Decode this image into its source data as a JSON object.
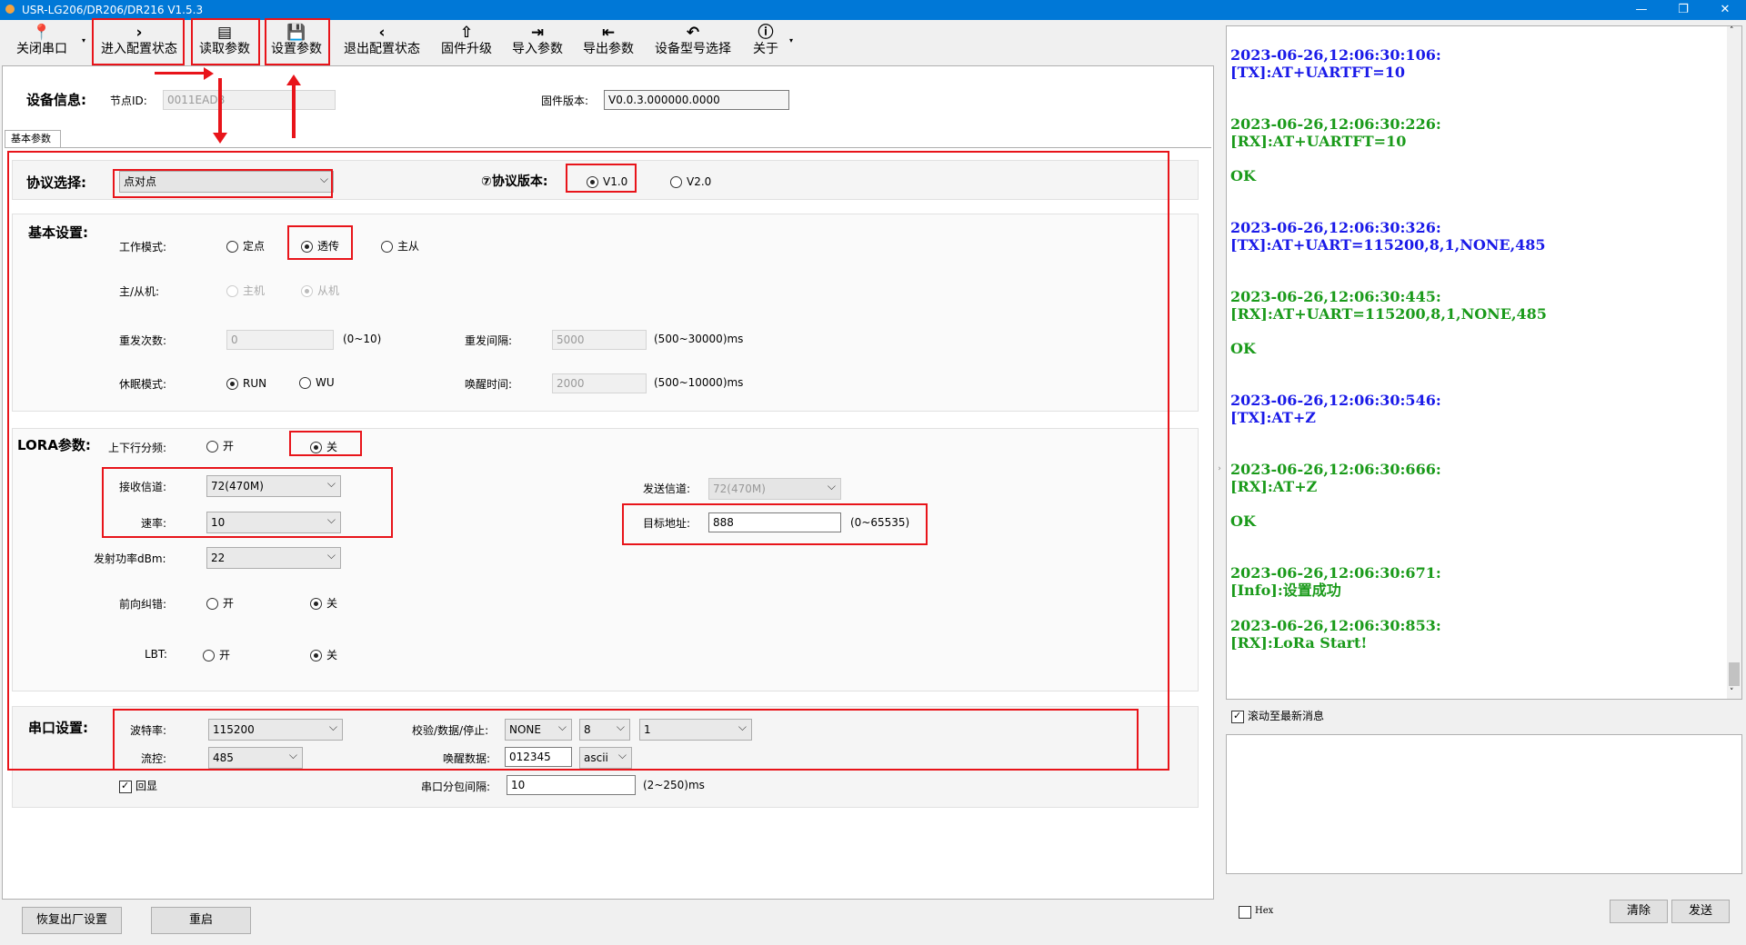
{
  "window": {
    "title": "USR-LG206/DR206/DR216 V1.5.3",
    "minimize": "—",
    "restore": "❐",
    "close": "✕"
  },
  "toolbar": {
    "items": [
      {
        "icon": "📍",
        "label": "关闭串口"
      },
      {
        "icon": "›",
        "label": "进入配置状态"
      },
      {
        "icon": "▤",
        "label": "读取参数"
      },
      {
        "icon": "💾",
        "label": "设置参数"
      },
      {
        "icon": "‹",
        "label": "退出配置状态"
      },
      {
        "icon": "⇧",
        "label": "固件升级"
      },
      {
        "icon": "⇥",
        "label": "导入参数"
      },
      {
        "icon": "⇤",
        "label": "导出参数"
      },
      {
        "icon": "↶",
        "label": "设备型号选择"
      },
      {
        "icon": "ⓘ",
        "label": "关于"
      }
    ]
  },
  "device_info": {
    "title": "设备信息:",
    "node_id_label": "节点ID:",
    "node_id_value": "0011EAD8",
    "firmware_label": "固件版本:",
    "firmware_value": "V0.0.3.000000.0000"
  },
  "tab": {
    "label": "基本参数"
  },
  "protocol": {
    "label": "协议选择:",
    "value": "点对点",
    "version_label": "⑦协议版本:",
    "v1": "V1.0",
    "v2": "V2.0"
  },
  "basic": {
    "title": "基本设置:",
    "work_mode_label": "工作模式:",
    "work_modes": [
      "定点",
      "透传",
      "主从"
    ],
    "master_slave_label": "主/从机:",
    "master": "主机",
    "slave": "从机",
    "retry_label": "重发次数:",
    "retry_value": "0",
    "retry_range": "(0~10)",
    "retry_interval_label": "重发间隔:",
    "retry_interval_value": "5000",
    "retry_interval_range": "(500~30000)ms",
    "sleep_label": "休眠模式:",
    "sleep_run": "RUN",
    "sleep_wu": "WU",
    "wake_time_label": "唤醒时间:",
    "wake_time_value": "2000",
    "wake_time_range": "(500~10000)ms"
  },
  "lora": {
    "title": "LORA参数:",
    "split_label": "上下行分频:",
    "on": "开",
    "off": "关",
    "rx_channel_label": "接收信道:",
    "rx_channel_value": "72(470M)",
    "rate_label": "速率:",
    "rate_value": "10",
    "power_label": "发射功率dBm:",
    "power_value": "22",
    "fec_label": "前向纠错:",
    "lbt_label": "LBT:",
    "tx_channel_label": "发送信道:",
    "tx_channel_value": "72(470M)",
    "target_label": "目标地址:",
    "target_value": "888",
    "target_range": "(0~65535)"
  },
  "serial": {
    "title": "串口设置:",
    "baud_label": "波特率:",
    "baud_value": "115200",
    "check_label": "校验/数据/停止:",
    "parity": "NONE",
    "data_bits": "8",
    "stop_bits": "1",
    "flow_label": "流控:",
    "flow_value": "485",
    "wake_data_label": "唤醒数据:",
    "wake_data_value": "012345",
    "wake_data_format": "ascii",
    "echo_label": "回显",
    "packet_interval_label": "串口分包间隔:",
    "packet_interval_value": "10",
    "packet_interval_range": "(2~250)ms"
  },
  "bottom": {
    "factory_reset": "恢复出厂设置",
    "restart": "重启"
  },
  "log": [
    {
      "time": "2023-06-26,12:06:30:106:",
      "msg": "[TX]:AT+UARTFT=10",
      "ok": "",
      "kind": "tx"
    },
    {
      "time": "2023-06-26,12:06:30:226:",
      "msg": "[RX]:AT+UARTFT=10",
      "ok": "OK",
      "kind": "rx"
    },
    {
      "time": "2023-06-26,12:06:30:326:",
      "msg": "[TX]:AT+UART=115200,8,1,NONE,485",
      "ok": "",
      "kind": "tx"
    },
    {
      "time": "2023-06-26,12:06:30:445:",
      "msg": "[RX]:AT+UART=115200,8,1,NONE,485",
      "ok": "OK",
      "kind": "rx"
    },
    {
      "time": "2023-06-26,12:06:30:546:",
      "msg": "[TX]:AT+Z",
      "ok": "",
      "kind": "tx"
    },
    {
      "time": "2023-06-26,12:06:30:666:",
      "msg": "[RX]:AT+Z",
      "ok": "OK",
      "kind": "rx"
    },
    {
      "time": "2023-06-26,12:06:30:671:",
      "msg": "[Info]:设置成功",
      "ok": "",
      "kind": "rx"
    },
    {
      "time": "2023-06-26,12:06:30:853:",
      "msg": "[RX]:LoRa Start!",
      "ok": "",
      "kind": "rx"
    }
  ],
  "right_controls": {
    "autoscroll": "滚动至最新消息",
    "hex": "Hex",
    "clear": "清除",
    "send": "发送"
  },
  "colors": {
    "highlight": "#e8141a",
    "tx": "#1a1ae8",
    "rx": "#1a9a1a",
    "titlebar": "#0078d7"
  }
}
